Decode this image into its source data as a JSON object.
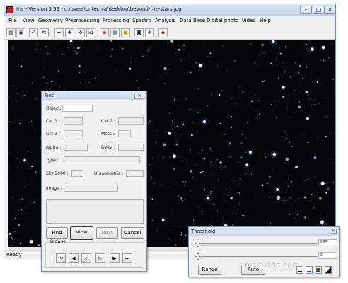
{
  "window": {
    "title": "Iris - Version 5.59 - c:\\users\\ontecnia\\desktop\\beyond-the-stars.jpg",
    "controls": {
      "minimize": "–",
      "maximize": "□",
      "close": "✕"
    }
  },
  "menu": [
    "File",
    "View",
    "Geometry",
    "Preprocessing",
    "Processing",
    "Spectro",
    "Analysis",
    "Data Base",
    "Digital photo",
    "Video",
    "Help"
  ],
  "toolbar": {
    "icons": [
      "open-icon",
      "save-icon",
      "undo-icon",
      "redo-icon",
      "crosshair-icon",
      "zoom-in-icon",
      "zoom-out-icon",
      "x1-icon",
      "red-circle-icon",
      "palette-icon",
      "yellow-square-icon",
      "camera-icon",
      "grid-icon",
      "red-diamond-icon"
    ],
    "glyphs": [
      "▤",
      "▣",
      "↶",
      "⇆",
      "✛",
      "✚",
      "✜",
      "x1",
      "◉",
      "▦",
      "■",
      "◙",
      "✥",
      "◆"
    ]
  },
  "status": {
    "text": "Ready"
  },
  "find_dialog": {
    "title": "Find",
    "close": "✕",
    "labels": {
      "object": "Object:",
      "cat1": "Cat 1 :",
      "cat2": "Cat 2 :",
      "cat3": "Cat 3 :",
      "mess": "Mess :",
      "alpha": "Alpha :",
      "delta": "Delta :",
      "type": "Type :",
      "sky2000": "Sky 2000 :",
      "uranometria": "Uranometria :",
      "image": "Image :"
    },
    "buttons": {
      "find": "Find",
      "view": "View",
      "next": "Next",
      "cancel": "Cancel"
    },
    "browse": {
      "label": "Browse",
      "buttons": [
        "⏮",
        "◀",
        "◁",
        "▷",
        "▶",
        "⏭"
      ]
    }
  },
  "threshold": {
    "title": "Threshold",
    "close": "✕",
    "high_value": "255",
    "low_value": "0",
    "buttons": {
      "range": "Range",
      "auto": "Auto"
    }
  },
  "watermark": "malavida.com"
}
